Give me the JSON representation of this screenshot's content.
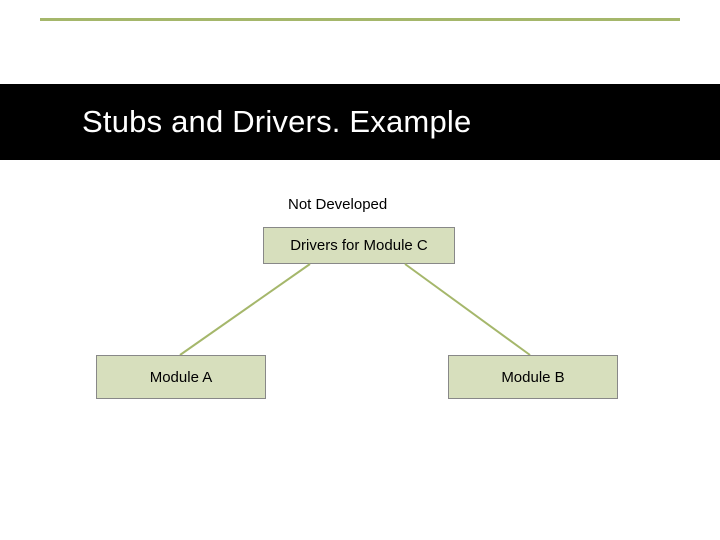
{
  "title": "Stubs and Drivers. Example",
  "notDeveloped": "Not Developed",
  "topBox": "Drivers for Module C",
  "moduleA": "Module A",
  "moduleB": "Module B"
}
